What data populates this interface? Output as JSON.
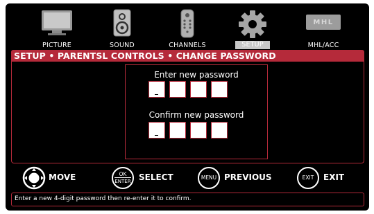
{
  "top_menu": [
    {
      "label": "PICTURE",
      "icon": "monitor-icon",
      "selected": false
    },
    {
      "label": "SOUND",
      "icon": "speaker-icon",
      "selected": false
    },
    {
      "label": "CHANNELS",
      "icon": "remote-icon",
      "selected": false
    },
    {
      "label": "SETUP",
      "icon": "gear-icon",
      "selected": true
    },
    {
      "label": "MHL/ACC",
      "icon": "mhl-logo-icon",
      "selected": false
    }
  ],
  "mhl_logo_text": "MHL",
  "title": "SETUP • PARENTSL CONTROLS • CHANGE PASSWORD",
  "password": {
    "enter_label": "Enter new password",
    "confirm_label": "Confirm new password",
    "digits": 4
  },
  "legend": {
    "move_label": "MOVE",
    "select_label": "SELECT",
    "ok_top": "OK",
    "ok_bottom": "ENTER",
    "previous_label": "PREVIOUS",
    "menu_button": "MENU",
    "exit_label": "EXIT",
    "exit_button": "EXIT"
  },
  "help_text": "Enter a new 4-digit password then re-enter it to confirm.",
  "colors": {
    "accent": "#b52a3a",
    "background": "#000000",
    "text": "#ffffff"
  }
}
